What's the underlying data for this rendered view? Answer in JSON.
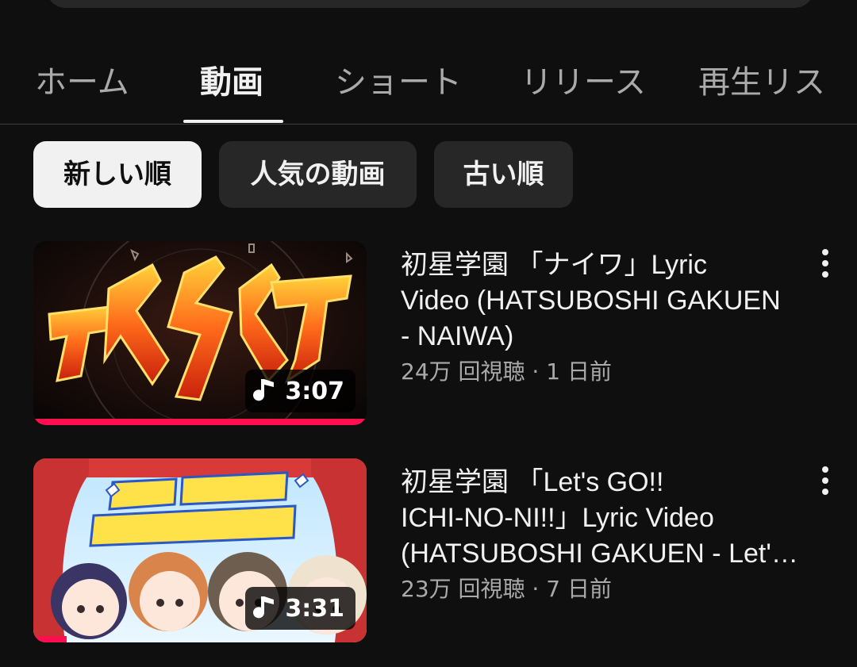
{
  "tabs": [
    {
      "label": "ホーム",
      "active": false
    },
    {
      "label": "動画",
      "active": true
    },
    {
      "label": "ショート",
      "active": false
    },
    {
      "label": "リリース",
      "active": false
    },
    {
      "label": "再生リス",
      "active": false
    }
  ],
  "chips": [
    {
      "label": "新しい順",
      "selected": true
    },
    {
      "label": "人気の動画",
      "selected": false
    },
    {
      "label": "古い順",
      "selected": false
    }
  ],
  "videos": [
    {
      "title_lines": [
        "初星学園 「ナイワ」Lyric",
        "Video (HATSUBOSHI GAKUEN",
        "- NAIWA)"
      ],
      "views": "24万 回視聴",
      "age": "1 日前",
      "duration": "3:07",
      "duration_icon": "music-note-icon",
      "watched_fraction": 1.0
    },
    {
      "title_lines": [
        "初星学園 「Let's GO!!",
        "ICHI-NO-NI!!」Lyric Video",
        "(HATSUBOSHI GAKUEN - Let'…"
      ],
      "views": "23万 回視聴",
      "age": "7 日前",
      "duration": "3:31",
      "duration_icon": "music-note-icon",
      "watched_fraction": 0.1
    }
  ],
  "stats_separator": " · ",
  "colors": {
    "background": "#0f0f0f",
    "chip": "#272727",
    "chip_selected": "#f1f1f1",
    "progress": "#ff0f4f",
    "text_secondary": "#aaaaaa"
  }
}
